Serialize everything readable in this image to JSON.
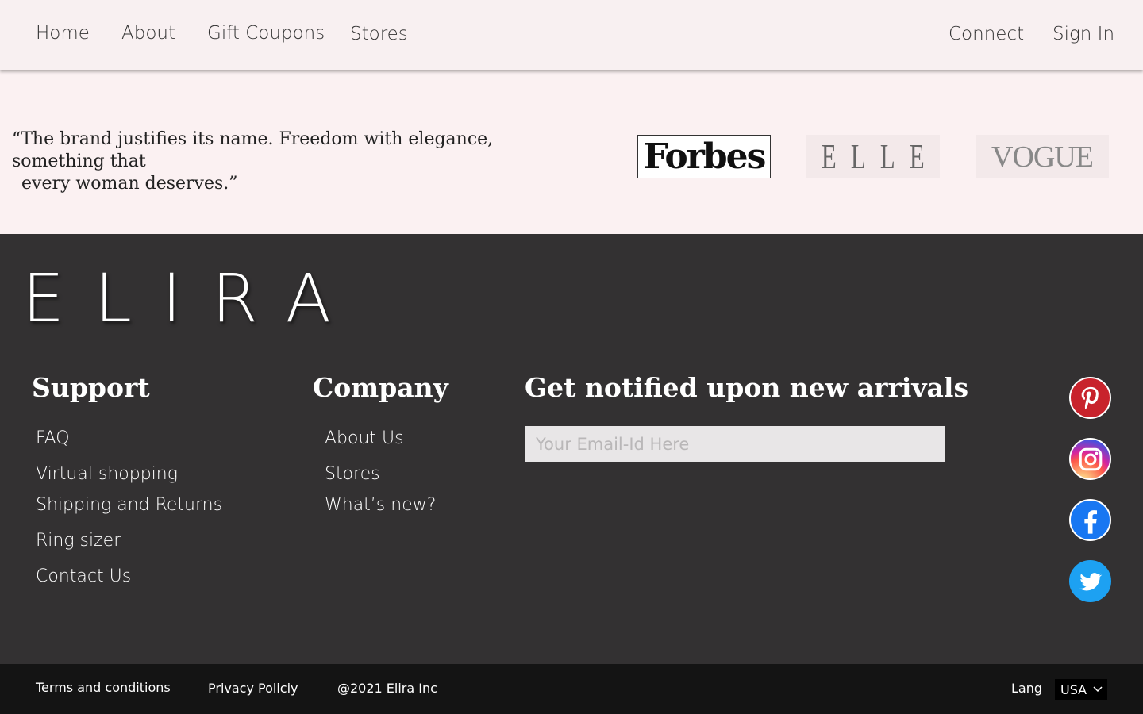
{
  "nav": {
    "left": [
      "Home",
      "About",
      "Gift Coupons",
      "Stores"
    ],
    "right": [
      "Connect",
      "Sign In"
    ]
  },
  "press": {
    "quote_line1": "“The brand justifies its name. Freedom with elegance, something that",
    "quote_line2": "every woman deserves.”",
    "logos": [
      "Forbes",
      "ELLE",
      "VOGUE"
    ]
  },
  "footer": {
    "brand": "ELIRA",
    "support": {
      "heading": "Support",
      "links": [
        "FAQ",
        "Virtual shopping",
        "Shipping and Returns",
        "Ring sizer",
        "Contact Us"
      ]
    },
    "company": {
      "heading": "Company",
      "links": [
        "About Us",
        "Stores",
        "What’s new?"
      ]
    },
    "notify": {
      "heading": "Get notified upon new arrivals",
      "placeholder": "Your Email-Id Here"
    },
    "social_icons": [
      "pinterest-icon",
      "instagram-icon",
      "facebook-icon",
      "twitter-icon"
    ]
  },
  "bottom": {
    "terms": "Terms and conditions",
    "privacy": "Privacy Policiy",
    "copyright": "@2021 Elira Inc",
    "lang_label": "Lang",
    "lang_value": "USA"
  },
  "colors": {
    "nav_bg": "#f8f0f1",
    "press_bg": "#fbf1f2",
    "footer_bg": "#333132",
    "bottom_bg": "#141414"
  }
}
